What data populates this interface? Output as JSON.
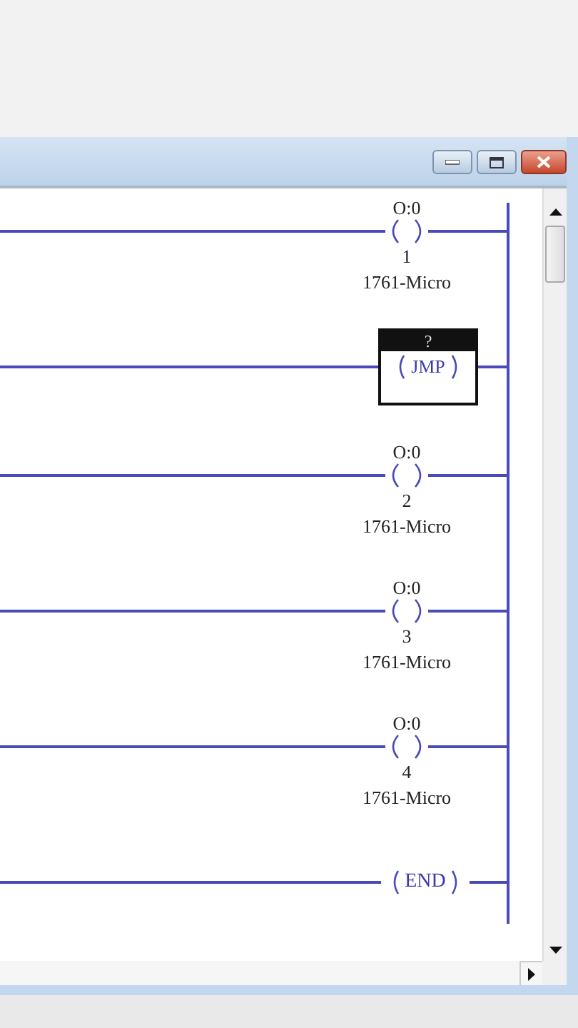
{
  "window": {
    "buttons": [
      {
        "kind": "minimize"
      },
      {
        "kind": "maximize"
      },
      {
        "kind": "close"
      }
    ]
  },
  "rungs": [
    {
      "kind": "coil",
      "address": "O:0",
      "bit": "1",
      "description": "1761-Micro"
    },
    {
      "kind": "jmp",
      "label": "?",
      "mnemonic": "JMP"
    },
    {
      "kind": "coil",
      "address": "O:0",
      "bit": "2",
      "description": "1761-Micro"
    },
    {
      "kind": "coil",
      "address": "O:0",
      "bit": "3",
      "description": "1761-Micro"
    },
    {
      "kind": "coil",
      "address": "O:0",
      "bit": "4",
      "description": "1761-Micro"
    },
    {
      "kind": "end",
      "mnemonic": "END"
    }
  ]
}
